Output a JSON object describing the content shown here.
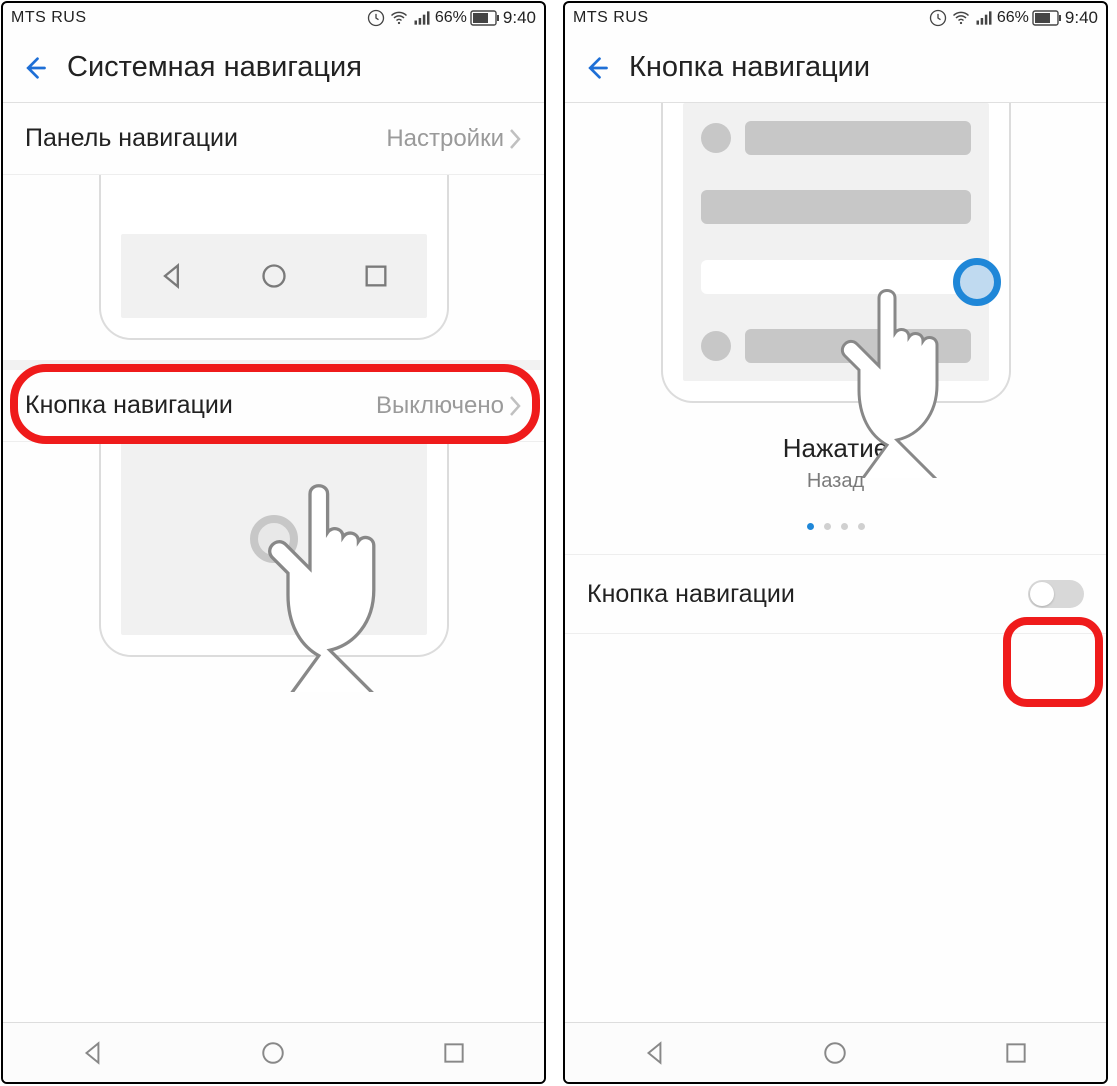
{
  "status": {
    "carrier": "MTS RUS",
    "battery_pct": "66%",
    "time": "9:40"
  },
  "screen1": {
    "title": "Системная навигация",
    "row1": {
      "label": "Панель навигации",
      "value": "Настройки"
    },
    "row2": {
      "label": "Кнопка навигации",
      "value": "Выключено"
    }
  },
  "screen2": {
    "title": "Кнопка навигации",
    "caption_title": "Нажатие",
    "caption_sub": "Назад",
    "toggle_label": "Кнопка навигации"
  }
}
